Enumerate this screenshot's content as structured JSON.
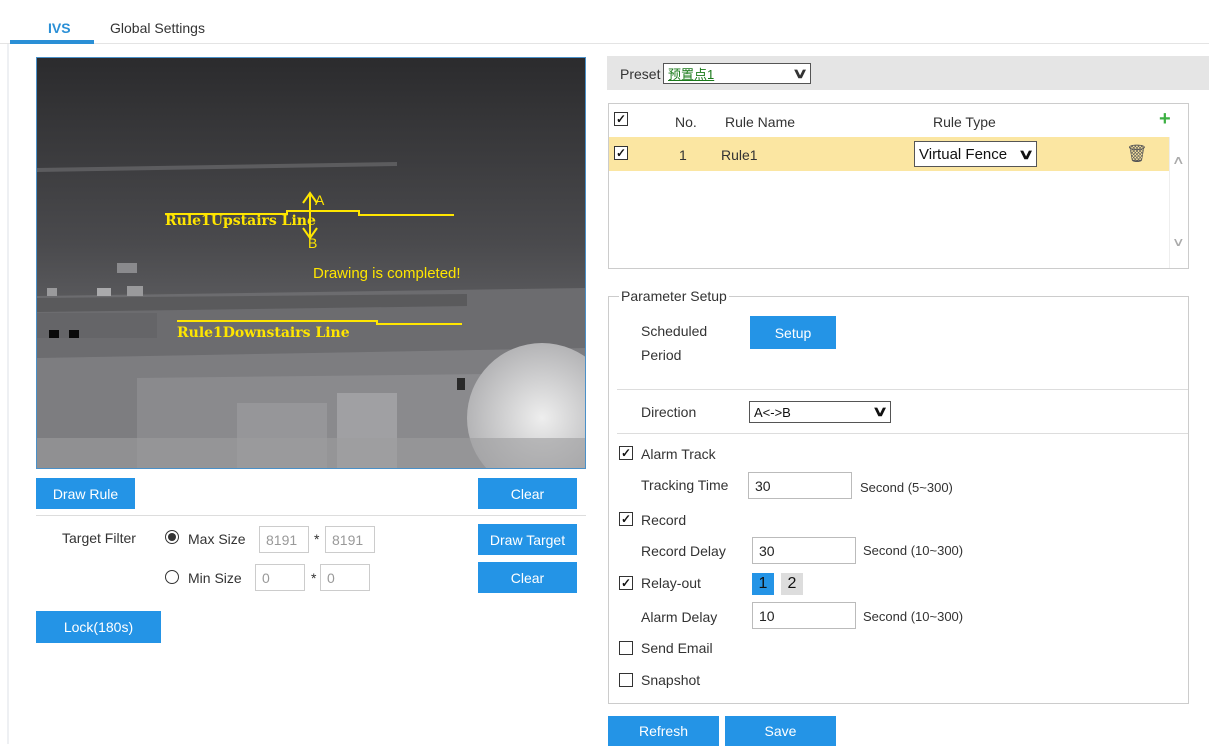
{
  "tabs": [
    {
      "label": "IVS"
    },
    {
      "label": "Global Settings"
    }
  ],
  "video": {
    "point_a": "A",
    "point_b": "B",
    "upstairs_label": "Rule1Upstairs Line",
    "downstairs_label": "Rule1Downstairs Line",
    "status_text": "Drawing is completed!"
  },
  "left": {
    "draw_rule": "Draw Rule",
    "clear": "Clear",
    "target_filter": "Target Filter",
    "max_size": "Max Size",
    "max_w": "8191",
    "max_h": "8191",
    "star": "*",
    "min_size": "Min Size",
    "min_w": "0",
    "min_h": "0",
    "draw_target": "Draw Target",
    "clear2": "Clear",
    "lock": "Lock(180s)"
  },
  "preset": {
    "label": "Preset",
    "value": "预置点1"
  },
  "rules": {
    "headers": {
      "no": "No.",
      "name": "Rule Name",
      "type": "Rule Type"
    },
    "rows": [
      {
        "no": "1",
        "name": "Rule1",
        "type": "Virtual Fence"
      }
    ]
  },
  "params": {
    "legend": "Parameter Setup",
    "scheduled": "Scheduled",
    "period": "Period",
    "setup": "Setup",
    "direction": "Direction",
    "direction_value": "A<->B",
    "alarm_track": "Alarm Track",
    "tracking_time": "Tracking Time",
    "tracking_value": "30",
    "tracking_unit": "Second (5~300)",
    "record": "Record",
    "record_delay": "Record Delay",
    "record_value": "30",
    "record_unit": "Second (10~300)",
    "relay_out": "Relay-out",
    "relay1": "1",
    "relay2": "2",
    "alarm_delay": "Alarm Delay",
    "alarm_value": "10",
    "alarm_unit": "Second (10~300)",
    "send_email": "Send Email",
    "snapshot": "Snapshot"
  },
  "footer": {
    "refresh": "Refresh",
    "save": "Save"
  },
  "colors": {
    "accent": "#2494e6",
    "overlay": "#ffe600",
    "row_highlight": "#fbe6a2",
    "add": "#3cb043"
  }
}
